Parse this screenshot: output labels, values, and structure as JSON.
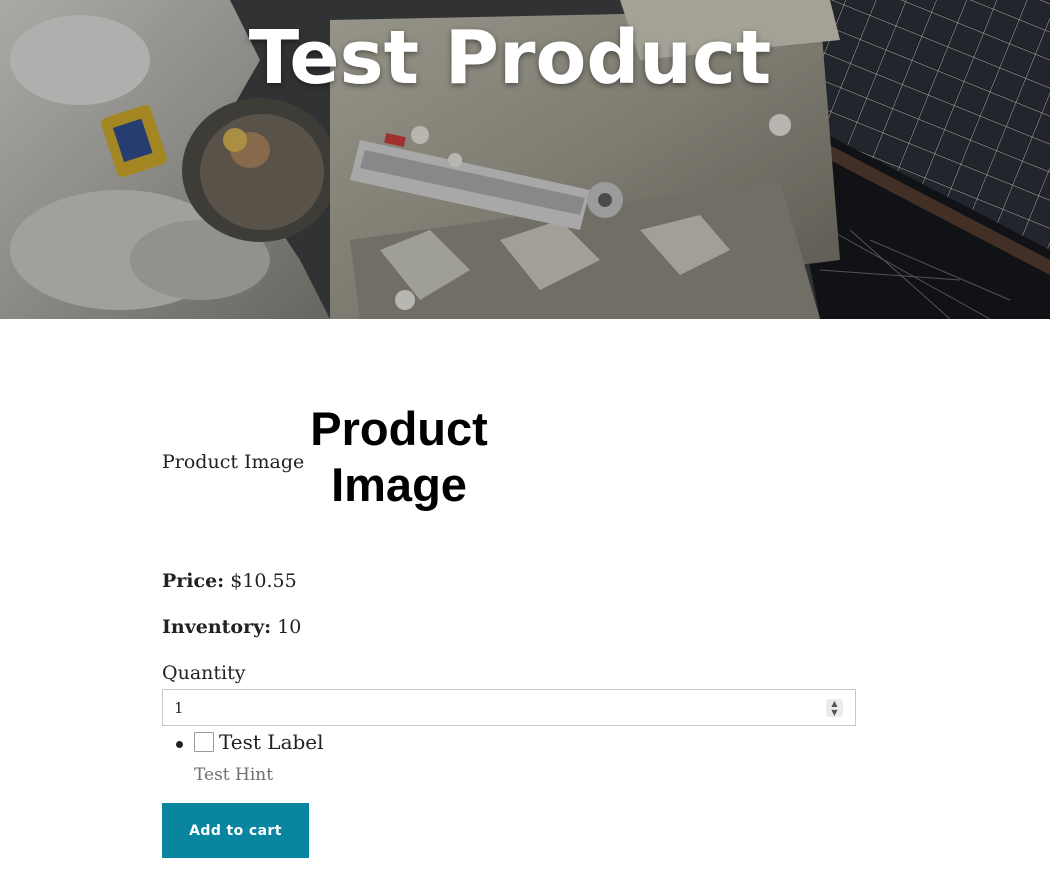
{
  "hero": {
    "title": "Test Product",
    "background_image": "astronaut-spacewalk-photo"
  },
  "product": {
    "image_alt_text": "Product Image",
    "image_placeholder_text": "Product Image",
    "price_label": "Price:",
    "price_value": "$10.55",
    "inventory_label": "Inventory:",
    "inventory_value": "10"
  },
  "quantity": {
    "label": "Quantity",
    "value": "1"
  },
  "options": [
    {
      "label": "Test Label",
      "hint": "Test Hint",
      "checked": false
    }
  ],
  "actions": {
    "add_to_cart_label": "Add to cart"
  },
  "colors": {
    "button_bg": "#0a85a0",
    "button_text": "#ffffff",
    "hint_text": "#6f6f6f"
  },
  "icons": {
    "spinner": "number-spinner-icon",
    "bullet": "list-bullet-icon"
  }
}
